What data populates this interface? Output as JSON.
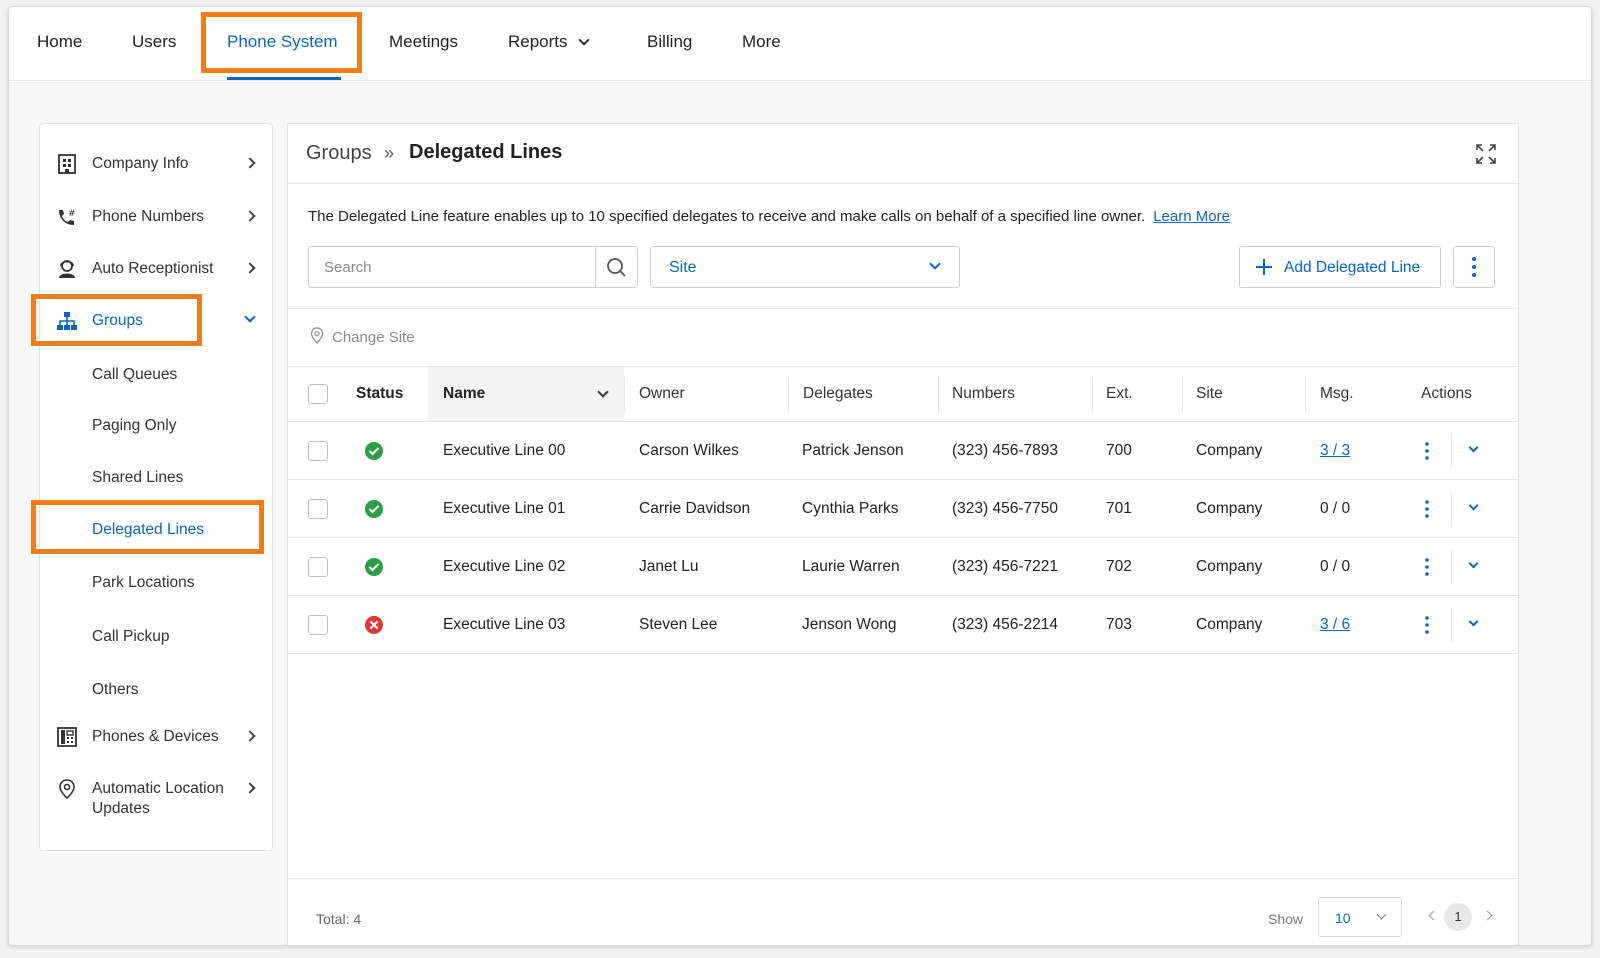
{
  "nav": {
    "items": [
      {
        "label": "Home"
      },
      {
        "label": "Users"
      },
      {
        "label": "Phone System"
      },
      {
        "label": "Meetings"
      },
      {
        "label": "Reports"
      },
      {
        "label": "Billing"
      },
      {
        "label": "More"
      }
    ],
    "active": "Phone System"
  },
  "sidebar": {
    "items": [
      {
        "label": "Company Info",
        "icon": "building-icon"
      },
      {
        "label": "Phone Numbers",
        "icon": "phone-hash-icon"
      },
      {
        "label": "Auto Receptionist",
        "icon": "receptionist-icon"
      },
      {
        "label": "Groups",
        "icon": "org-chart-icon"
      },
      {
        "label": "Phones & Devices",
        "icon": "desk-phone-icon"
      },
      {
        "label": "Automatic Location",
        "label2": "Updates",
        "icon": "location-pin-icon"
      }
    ],
    "groups_sub": [
      {
        "label": "Call Queues"
      },
      {
        "label": "Paging Only"
      },
      {
        "label": "Shared Lines"
      },
      {
        "label": "Delegated Lines"
      },
      {
        "label": "Park Locations"
      },
      {
        "label": "Call Pickup"
      },
      {
        "label": "Others"
      }
    ]
  },
  "breadcrumb": {
    "root": "Groups",
    "sep": "»",
    "current": "Delegated Lines"
  },
  "description": {
    "text": "The Delegated Line feature enables up to 10 specified delegates to receive and make calls on behalf of a specified line owner.",
    "link": "Learn More"
  },
  "toolbar": {
    "search_placeholder": "Search",
    "site_label": "Site",
    "add_label": "Add Delegated Line",
    "change_site": "Change Site"
  },
  "table": {
    "headers": {
      "status": "Status",
      "name": "Name",
      "owner": "Owner",
      "delegates": "Delegates",
      "numbers": "Numbers",
      "ext": "Ext.",
      "site": "Site",
      "msg": "Msg.",
      "actions": "Actions"
    },
    "rows": [
      {
        "status": "ok",
        "name": "Executive Line 00",
        "owner": "Carson Wilkes",
        "delegates": "Patrick Jenson",
        "numbers": "(323) 456-7893",
        "ext": "700",
        "site": "Company",
        "msg": "3 / 3",
        "msg_link": true
      },
      {
        "status": "ok",
        "name": "Executive Line 01",
        "owner": "Carrie Davidson",
        "delegates": "Cynthia Parks",
        "numbers": "(323) 456-7750",
        "ext": "701",
        "site": "Company",
        "msg": "0 / 0",
        "msg_link": false
      },
      {
        "status": "ok",
        "name": "Executive Line 02",
        "owner": "Janet Lu",
        "delegates": "Laurie Warren",
        "numbers": "(323) 456-7221",
        "ext": "702",
        "site": "Company",
        "msg": "0 / 0",
        "msg_link": false
      },
      {
        "status": "error",
        "name": "Executive Line 03",
        "owner": "Steven Lee",
        "delegates": "Jenson Wong",
        "numbers": "(323) 456-2214",
        "ext": "703",
        "site": "Company",
        "msg": "3 / 6",
        "msg_link": true
      }
    ]
  },
  "footer": {
    "total": "Total: 4",
    "show_label": "Show",
    "page_size": "10",
    "current_page": "1"
  },
  "colors": {
    "accent": "#0a66c2",
    "highlight": "#f07d1c",
    "success": "#2e9e46",
    "error": "#d93a3a"
  }
}
